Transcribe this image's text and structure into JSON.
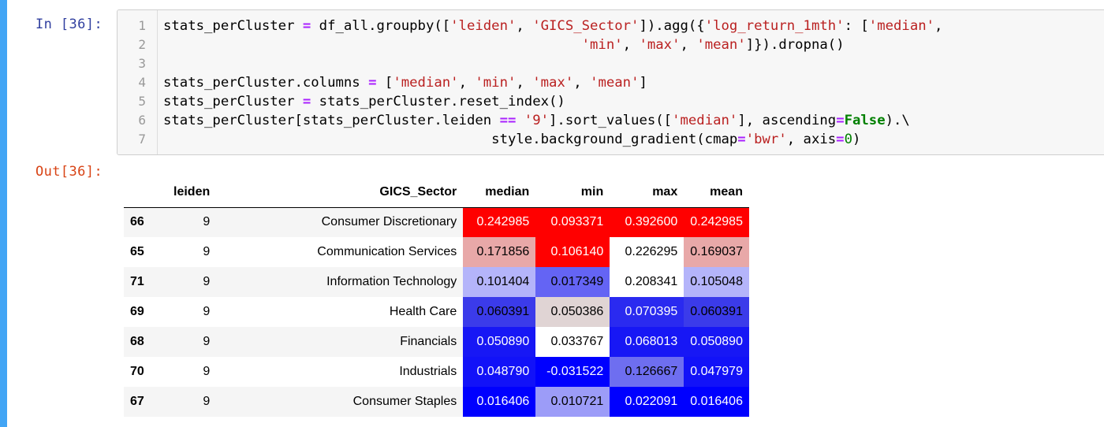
{
  "input_prompt": "In [36]:",
  "output_prompt": "Out[36]:",
  "line_numbers": [
    "1",
    "2",
    "3",
    "4",
    "5",
    "6",
    "7"
  ],
  "code": {
    "l1a": "stats_perCluster ",
    "l1b": "=",
    "l1c": " df_all.groupby([",
    "l1d": "'leiden'",
    "l1e": ", ",
    "l1f": "'GICS_Sector'",
    "l1g": "]).agg({",
    "l1h": "'log_return_1mth'",
    "l1i": ": [",
    "l1j": "'median'",
    "l1k": ",",
    "l2a": "                                                   ",
    "l2b": "'min'",
    "l2c": ", ",
    "l2d": "'max'",
    "l2e": ", ",
    "l2f": "'mean'",
    "l2g": "]}).dropna()",
    "l4a": "stats_perCluster.columns ",
    "l4b": "=",
    "l4c": " [",
    "l4d": "'median'",
    "l4e": ", ",
    "l4f": "'min'",
    "l4g": ", ",
    "l4h": "'max'",
    "l4i": ", ",
    "l4j": "'mean'",
    "l4k": "]",
    "l5a": "stats_perCluster ",
    "l5b": "=",
    "l5c": " stats_perCluster.reset_index()",
    "l6a": "stats_perCluster[stats_perCluster.leiden ",
    "l6b": "==",
    "l6c": " ",
    "l6d": "'9'",
    "l6e": "].sort_values([",
    "l6f": "'median'",
    "l6g": "], ascending",
    "l6h": "=",
    "l6i": "False",
    "l6j": ").\\",
    "l7a": "                                        style.background_gradient(cmap",
    "l7b": "=",
    "l7c": "'bwr'",
    "l7d": ", axis",
    "l7e": "=",
    "l7f": "0",
    "l7g": ")"
  },
  "table": {
    "headers": [
      "",
      "leiden",
      "GICS_Sector",
      "median",
      "min",
      "max",
      "mean"
    ],
    "rows": [
      {
        "index": "66",
        "leiden": "9",
        "sector": "Consumer Discretionary",
        "median": "0.242985",
        "min": "0.093371",
        "max": "0.392600",
        "mean": "0.242985"
      },
      {
        "index": "65",
        "leiden": "9",
        "sector": "Communication Services",
        "median": "0.171856",
        "min": "0.106140",
        "max": "0.226295",
        "mean": "0.169037"
      },
      {
        "index": "71",
        "leiden": "9",
        "sector": "Information Technology",
        "median": "0.101404",
        "min": "0.017349",
        "max": "0.208341",
        "mean": "0.105048"
      },
      {
        "index": "69",
        "leiden": "9",
        "sector": "Health Care",
        "median": "0.060391",
        "min": "0.050386",
        "max": "0.070395",
        "mean": "0.060391"
      },
      {
        "index": "68",
        "leiden": "9",
        "sector": "Financials",
        "median": "0.050890",
        "min": "0.033767",
        "max": "0.068013",
        "mean": "0.050890"
      },
      {
        "index": "70",
        "leiden": "9",
        "sector": "Industrials",
        "median": "0.048790",
        "min": "-0.031522",
        "max": "0.126667",
        "mean": "0.047979"
      },
      {
        "index": "67",
        "leiden": "9",
        "sector": "Consumer Staples",
        "median": "0.016406",
        "min": "0.010721",
        "max": "0.022091",
        "mean": "0.016406"
      }
    ],
    "cell_colors": [
      {
        "median": "#ff0000",
        "min": "#ff0000",
        "max": "#ff0000",
        "mean": "#ff0000"
      },
      {
        "median": "#e8a8a8",
        "min": "#ff0000",
        "max": "#ffffff",
        "mean": "#e8a8a8"
      },
      {
        "median": "#b4b4fa",
        "min": "#6464f4",
        "max": "#ffffff",
        "mean": "#b4b4fa"
      },
      {
        "median": "#3b3bea",
        "min": "#e0d4d4",
        "max": "#2a2af0",
        "mean": "#3b3bea"
      },
      {
        "median": "#1717f5",
        "min": "#ffffff",
        "max": "#1717f5",
        "mean": "#1717f5"
      },
      {
        "median": "#1212f8",
        "min": "#0000ff",
        "max": "#6e6ef0",
        "mean": "#1212f8"
      },
      {
        "median": "#0000ff",
        "min": "#9c9cf8",
        "max": "#0000ff",
        "mean": "#0000ff"
      }
    ],
    "cell_text_colors": [
      {
        "median": "#ffffff",
        "min": "#ffffff",
        "max": "#ffffff",
        "mean": "#ffffff"
      },
      {
        "median": "#000000",
        "min": "#ffffff",
        "max": "#000000",
        "mean": "#000000"
      },
      {
        "median": "#000000",
        "min": "#000000",
        "max": "#000000",
        "mean": "#000000"
      },
      {
        "median": "#000000",
        "min": "#000000",
        "max": "#ffffff",
        "mean": "#000000"
      },
      {
        "median": "#ffffff",
        "min": "#000000",
        "max": "#ffffff",
        "mean": "#ffffff"
      },
      {
        "median": "#ffffff",
        "min": "#ffffff",
        "max": "#000000",
        "mean": "#ffffff"
      },
      {
        "median": "#ffffff",
        "min": "#000000",
        "max": "#ffffff",
        "mean": "#ffffff"
      }
    ]
  },
  "colors": {
    "selection_bar": "#42a5f5",
    "input_prompt": "#303f9f",
    "output_prompt": "#d84315"
  }
}
